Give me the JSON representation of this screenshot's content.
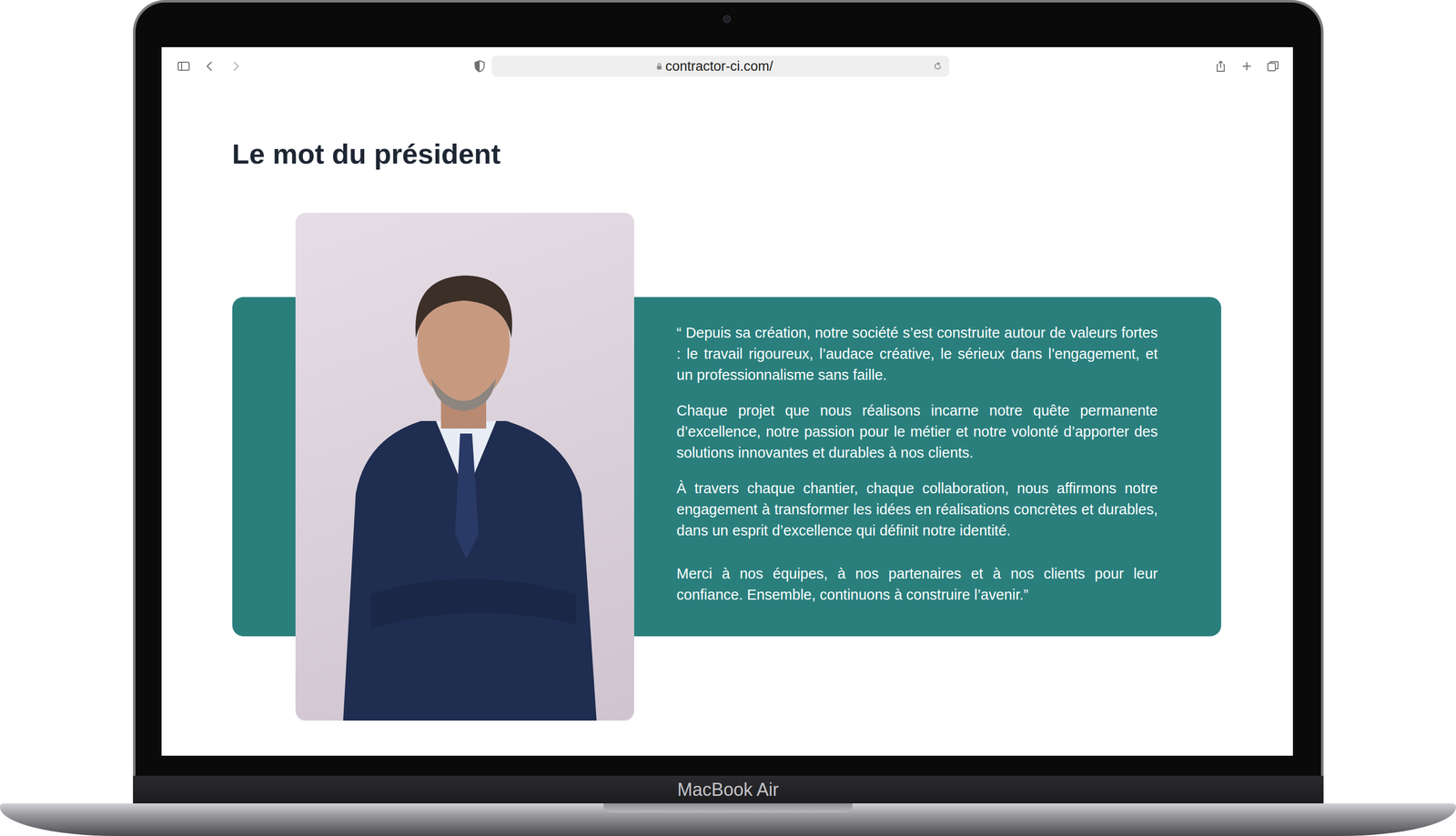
{
  "browser": {
    "url": "contractor-ci.com/"
  },
  "page": {
    "heading": "Le mot du président",
    "quote": [
      "“ Depuis sa création, notre société s’est construite autour de valeurs fortes : le travail rigoureux, l’audace créative, le sérieux dans l’engagement, et un professionnalisme sans faille.",
      "Chaque projet que nous réalisons incarne notre quête permanente d’excellence, notre passion pour le métier et notre volonté d’apporter des solutions innovantes et durables à nos clients.",
      "À travers chaque chantier, chaque collaboration, nous affirmons notre engagement à transformer les idées en réalisations concrètes et durables, dans un esprit d’excellence qui définit notre identité.",
      "Merci à nos équipes, à nos partenaires et à nos clients pour leur confiance. Ensemble, continuons à construire l’avenir.”"
    ]
  },
  "device": {
    "label": "MacBook Air"
  }
}
